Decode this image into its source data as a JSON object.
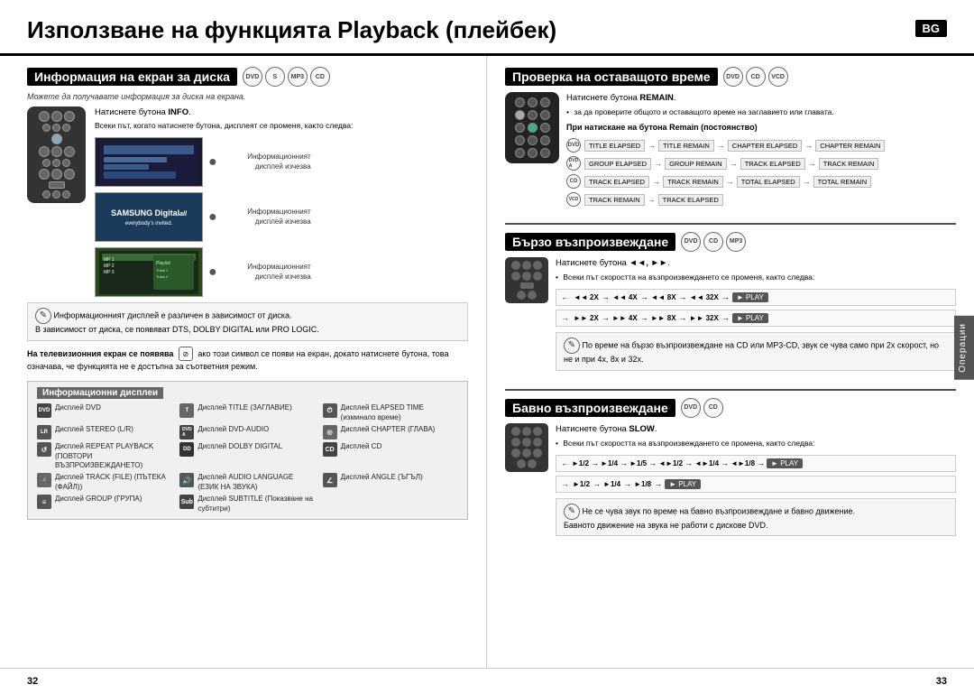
{
  "page": {
    "title": "Използване на функцията Playback (плейбек)",
    "badge": "BG",
    "page_left": "32",
    "page_right": "33",
    "operations_tab": "Операции"
  },
  "left_section": {
    "title": "Информация на екран за диска",
    "subtitle_note": "Можете да получавате информация за диска на екрана.",
    "info_button": "Натиснете бутона INFO.",
    "info_note": "Всеки път, когато натиснете бутона, дисплеят се променя, както следва:",
    "screen_label1": "Информационният дисплей изчезва",
    "screen_label2": "Информационният дисплей изчезва",
    "screen_label3": "Информационният дисплей изчезва",
    "note_text1": "Информационният дисплей е различен в зависимост от диска.",
    "note_text2": "В зависимост от диска, се появяват DTS, DOLBY DIGITAL или PRO LOGIC.",
    "tv_section_title": "На телевизионния екран се появява",
    "tv_section_text": "ако този символ се появи на екран, докато натиснете бутона, това означава, че функцията не е достъпна за съответния режим.",
    "displays_title": "Информационни дисплеи",
    "displays": [
      {
        "icon": "DVD",
        "label1": "Дисплей DVD",
        "label2": "Дисплей TITLE (ЗАГЛАВИЕ)"
      },
      {
        "icon": "⏱",
        "label1": "Дисплей ELAPSED TIME (изминало време)"
      },
      {
        "icon": "LR",
        "label1": "Дисплей STEREO (L/R)"
      },
      {
        "icon": "DVD\nA",
        "label1": "Дисплей DVD-AUDIO",
        "label2": "Дисплей CHAPTER (ГЛАВА)"
      },
      {
        "icon": "↺",
        "label1": "Дисплей REPEAT PLAYBACK (ПОВТОРИ ВЪЗПРОИЗВЕЖДАНЕТО)"
      },
      {
        "icon": "DD",
        "label1": "Дисплей DOLBY DIGITAL"
      },
      {
        "icon": "CD",
        "label1": "Дисплей CD",
        "label2": "Дисплей TRACK (FILE) (ПЪТЕКА (ФАЙЛ))"
      },
      {
        "icon": "🔊",
        "label1": "Дисплей AUDIO LANGUAGE (ЕЗИК НА ЗВУКА)"
      },
      {
        "icon": "∠",
        "label1": "Дисплей ANGLE (ЪГЪЛ)"
      },
      {
        "icon": "≡",
        "label1": "Дисплей GROUP (ГРУПА)"
      },
      {
        "icon": "≡≡",
        "label1": "Дисплей SUBTITLE (Показване на субтитри)"
      }
    ]
  },
  "right_section": {
    "remain_title": "Проверка на оставащото време",
    "remain_button": "Натиснете бутона REMAIN.",
    "remain_note": "за да проверите общото и оставащото време на заглавието или главата.",
    "remain_press_title": "При натискане на бутона Remain (постоянство)",
    "flows": [
      {
        "icon": "dvd",
        "items": [
          "TITLE ELAPSED",
          "TITLE REMAIN",
          "CHAPTER ELAPSED",
          "CHAPTER REMAIN"
        ]
      },
      {
        "icon": "dvda",
        "items": [
          "GROUP ELAPSED",
          "GROUP REMAIN",
          "TRACK ELAPSED",
          "TRACK REMAIN"
        ]
      },
      {
        "icon": "cd",
        "items": [
          "TRACK ELAPSED",
          "TRACK REMAIN",
          "TOTAL ELAPSED",
          "TOTAL REMAIN"
        ]
      },
      {
        "icon": "vcd",
        "items": [
          "TRACK REMAIN",
          "TRACK ELAPSED"
        ]
      }
    ],
    "fast_title": "Бързо възпроизвеждане",
    "fast_button": "Натиснете бутона ◄◄, ►►.",
    "fast_note": "Всеки път скоростта на възпроизвеждането се променя, както следва:",
    "fast_row1": [
      "◄◄ 2X",
      "◄◄ 4X",
      "◄◄ 8X",
      "◄◄ 32X",
      "► PLAY"
    ],
    "fast_row2": [
      "►► 2X",
      "►► 4X",
      "►► 8X",
      "►► 32X",
      "► PLAY"
    ],
    "fast_cd_note": "По време на бързо възпроизвеждане на CD или MP3-CD, звук се чува само при 2х скорост, но не и при 4х, 8х и 32х.",
    "slow_title": "Бавно възпроизвеждане",
    "slow_button": "Натиснете бутона SLOW.",
    "slow_note": "Всеки път скоростта на възпроизвеждането се промена, както следва:",
    "slow_row1": [
      "►1/2",
      "►1/4",
      "►1/5",
      "◄►1/2",
      "◄►1/4",
      "◄►1/8",
      "► PLAY"
    ],
    "slow_row2": [
      "►1/2",
      "►1/4",
      "►1/8",
      "► PLAY"
    ],
    "slow_notes": [
      "Не се чува звук по време на бавно възпроизвеждане и бавно движение.",
      "Бавното движение на звука не работи с дискове DVD."
    ]
  }
}
